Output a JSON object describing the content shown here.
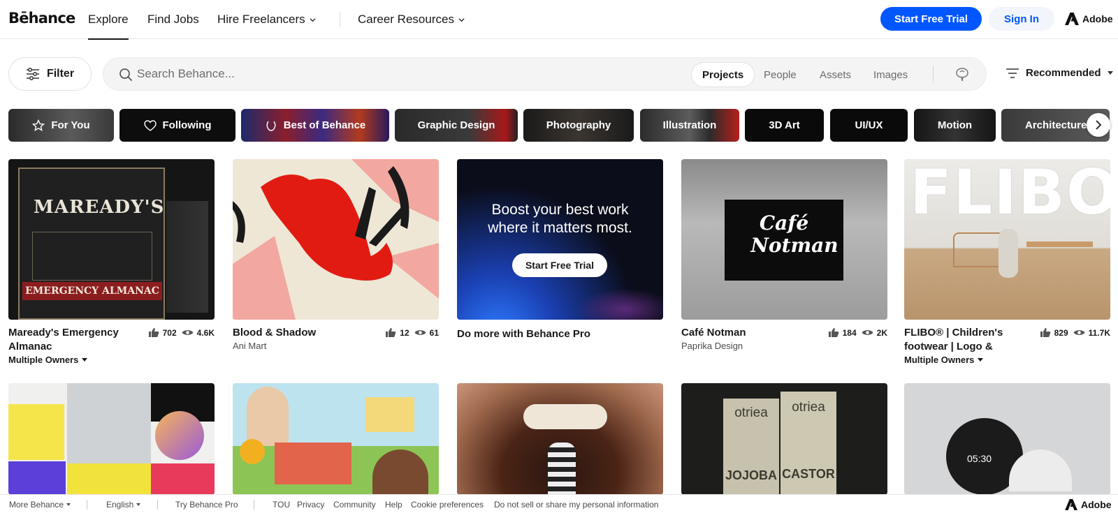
{
  "brand": {
    "logo": "Bēhance",
    "adobe": "Adobe"
  },
  "nav": {
    "explore": "Explore",
    "find_jobs": "Find Jobs",
    "hire_freelancers": "Hire Freelancers",
    "career_resources": "Career Resources",
    "start_trial": "Start Free Trial",
    "sign_in": "Sign In"
  },
  "search": {
    "filter": "Filter",
    "placeholder": "Search Behance...",
    "scopes": [
      "Projects",
      "People",
      "Assets",
      "Images"
    ],
    "sort": "Recommended"
  },
  "categories": [
    "For You",
    "Following",
    "Best of Behance",
    "Graphic Design",
    "Photography",
    "Illustration",
    "3D Art",
    "UI/UX",
    "Motion",
    "Architecture"
  ],
  "promo": {
    "headline_1": "Boost your best work",
    "headline_2": "where it matters most.",
    "cta": "Start Free Trial",
    "caption": "Do more with Behance Pro"
  },
  "projects": [
    {
      "title": "Maready's Emergency Almanac",
      "owner": "Multiple Owners",
      "likes": "702",
      "views": "4.6K",
      "thumb_text": [
        "MAREADY'S",
        "EMERGENCY ALMANAC"
      ]
    },
    {
      "title": "Blood & Shadow",
      "owner": "Ani Mart",
      "likes": "12",
      "views": "61"
    },
    {
      "title": "Café Notman",
      "owner": "Paprika Design",
      "likes": "184",
      "views": "2K",
      "thumb_text": [
        "Café",
        "Notman"
      ]
    },
    {
      "title": "FLIBO® | Children's footwear | Logo &",
      "owner": "Multiple Owners",
      "likes": "829",
      "views": "11.7K",
      "thumb_text": [
        "FLIBO"
      ]
    }
  ],
  "second_row": {
    "packaging": [
      "otriea",
      "otriea",
      "JOJOBA",
      "CASTOR"
    ],
    "clock": "05:30"
  },
  "footer": {
    "more": "More Behance",
    "language": "English",
    "try_pro": "Try Behance Pro",
    "links": [
      "TOU",
      "Privacy",
      "Community",
      "Help",
      "Cookie preferences",
      "Do not sell or share my personal information"
    ],
    "adobe": "Adobe"
  },
  "colors": {
    "accent": "#0057ff",
    "text": "#191919",
    "muted": "#6b6b6b"
  }
}
